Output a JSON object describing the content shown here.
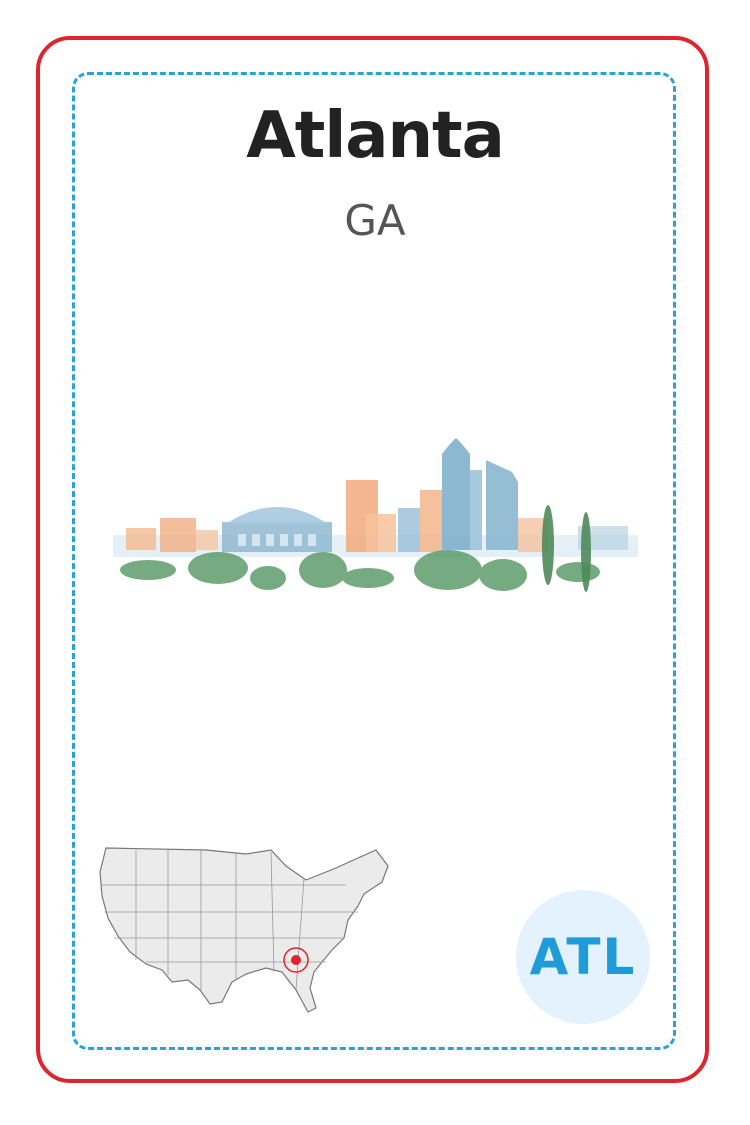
{
  "card": {
    "city": "Atlanta",
    "state": "GA",
    "code": "ATL",
    "illustration": "atlanta-skyline-watercolor",
    "map": "usa-map-with-georgia-marker"
  },
  "colors": {
    "border": "#e0242c",
    "dashed_border": "#29a3d6",
    "badge_bg": "#e3f2fc",
    "badge_text": "#1f9bd7",
    "marker": "#e0242c"
  }
}
